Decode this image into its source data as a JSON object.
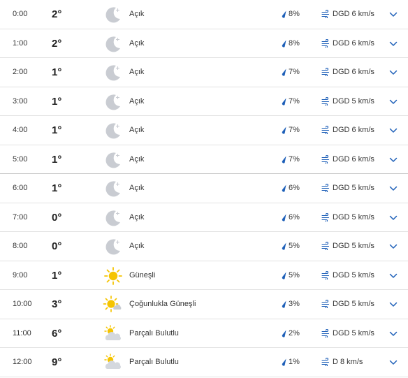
{
  "hours": [
    {
      "time": "0:00",
      "temp": "2°",
      "icon": "moon-clear-icon",
      "condition": "Açık",
      "precip": "8%",
      "wind": "DGD 6 km/s"
    },
    {
      "time": "1:00",
      "temp": "2°",
      "icon": "moon-clear-icon",
      "condition": "Açık",
      "precip": "8%",
      "wind": "DGD 6 km/s"
    },
    {
      "time": "2:00",
      "temp": "1°",
      "icon": "moon-clear-icon",
      "condition": "Açık",
      "precip": "7%",
      "wind": "DGD 6 km/s"
    },
    {
      "time": "3:00",
      "temp": "1°",
      "icon": "moon-clear-icon",
      "condition": "Açık",
      "precip": "7%",
      "wind": "DGD 5 km/s"
    },
    {
      "time": "4:00",
      "temp": "1°",
      "icon": "moon-clear-icon",
      "condition": "Açık",
      "precip": "7%",
      "wind": "DGD 6 km/s"
    },
    {
      "time": "5:00",
      "temp": "1°",
      "icon": "moon-clear-icon",
      "condition": "Açık",
      "precip": "7%",
      "wind": "DGD 6 km/s"
    },
    {
      "time": "6:00",
      "temp": "1°",
      "icon": "moon-clear-icon",
      "condition": "Açık",
      "precip": "6%",
      "wind": "DGD 5 km/s"
    },
    {
      "time": "7:00",
      "temp": "0°",
      "icon": "moon-clear-icon",
      "condition": "Açık",
      "precip": "6%",
      "wind": "DGD 5 km/s"
    },
    {
      "time": "8:00",
      "temp": "0°",
      "icon": "moon-clear-icon",
      "condition": "Açık",
      "precip": "5%",
      "wind": "DGD 5 km/s"
    },
    {
      "time": "9:00",
      "temp": "1°",
      "icon": "sun-icon",
      "condition": "Güneşli",
      "precip": "5%",
      "wind": "DGD 5 km/s"
    },
    {
      "time": "10:00",
      "temp": "3°",
      "icon": "sun-small-cloud-icon",
      "condition": "Çoğunlukla Güneşli",
      "precip": "3%",
      "wind": "DGD 5 km/s"
    },
    {
      "time": "11:00",
      "temp": "6°",
      "icon": "partly-cloudy-icon",
      "condition": "Parçalı Bulutlu",
      "precip": "2%",
      "wind": "DGD 5 km/s"
    },
    {
      "time": "12:00",
      "temp": "9°",
      "icon": "partly-cloudy-icon",
      "condition": "Parçalı Bulutlu",
      "precip": "1%",
      "wind": "D 8 km/s"
    }
  ],
  "colors": {
    "moon": "#c9ccd2",
    "sun": "#f5c400",
    "cloud": "#d4d8de",
    "drop": "#1d5fb8",
    "wind": "#1d5fb8",
    "chevron": "#1d5fb8"
  }
}
